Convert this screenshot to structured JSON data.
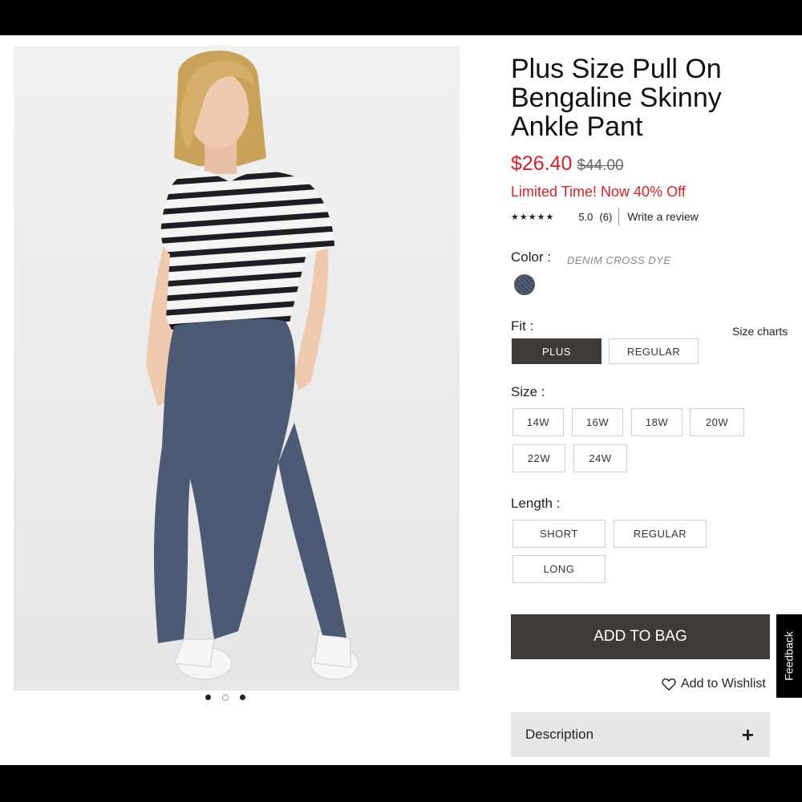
{
  "product": {
    "title": "Plus Size Pull On Bengaline Skinny Ankle Pant",
    "price": "$26.40",
    "original_price": "$44.00",
    "promo": "Limited Time! Now 40% Off",
    "rating_stars": "★★★★★",
    "rating_value": "5.0",
    "review_count": "(6)",
    "write_review": "Write a review"
  },
  "color": {
    "label": "Color :",
    "value": "DENIM CROSS DYE"
  },
  "fit": {
    "label": "Fit :",
    "size_charts": "Size charts",
    "options": [
      "PLUS",
      "REGULAR"
    ],
    "selected": "PLUS"
  },
  "size": {
    "label": "Size :",
    "options": [
      "14W",
      "16W",
      "18W",
      "20W",
      "22W",
      "24W"
    ]
  },
  "length": {
    "label": "Length :",
    "options": [
      "SHORT",
      "REGULAR",
      "LONG"
    ]
  },
  "actions": {
    "add_to_bag": "ADD TO BAG",
    "wishlist": "Add to Wishlist"
  },
  "description": {
    "label": "Description",
    "toggle": "+"
  },
  "feedback": "Feedback",
  "gallery": {
    "image_count": 3,
    "active_index": 0
  },
  "colors": {
    "price_red": "#d0222a",
    "button_dark": "#3e3a38"
  }
}
